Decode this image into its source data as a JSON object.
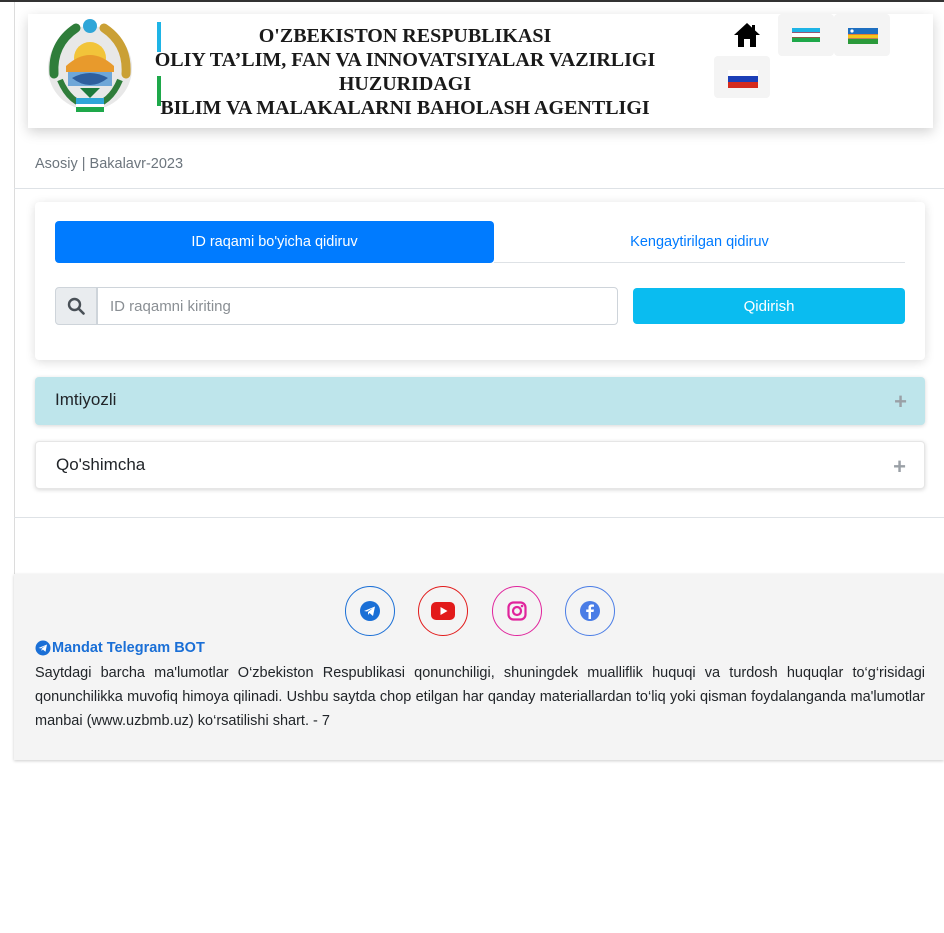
{
  "header": {
    "title_line1": "O'ZBEKISTON RESPUBLIKASI",
    "title_line2": "OLIY TA’LIM, FAN VA INNOVATSIYALAR VAZIRLIGI",
    "title_line3": "HUZURIDAGI",
    "title_line4": "BILIM VA MALAKALARNI BAHOLASH AGENTLIGI",
    "icons": [
      "emblem-icon",
      "home-icon",
      "flag-uz-icon",
      "flag-karakalpak-icon",
      "flag-ru-icon"
    ]
  },
  "breadcrumb": "Asosiy | Bakalavr-2023",
  "search": {
    "tab_active": "ID raqami bo'yicha qidiruv",
    "tab_inactive": "Kengaytirilgan qidiruv",
    "placeholder": "ID raqamni kiriting",
    "value": "",
    "button": "Qidirish"
  },
  "accordion": [
    {
      "label": "Imtiyozli",
      "toggle": "+"
    },
    {
      "label": "Qo'shimcha",
      "toggle": "+"
    }
  ],
  "footer": {
    "social": [
      "telegram-icon",
      "youtube-icon",
      "instagram-icon",
      "facebook-icon"
    ],
    "bot_label": "Mandat Telegram BOT",
    "text": "Saytdagi barcha ma'lumotlar O‘zbekiston Respublikasi qonunchiligi, shuningdek mualliflik huquqi va turdosh huquqlar to‘g‘risidagi qonunchilikka muvofiq himoya qilinadi. Ushbu saytda chop etilgan har qanday materiallardan to‘liq yoki qisman foydalanganda ma'lumotlar manbai (www.uzbmb.uz) ko‘rsatilishi shart. - 7"
  },
  "colors": {
    "primary": "#007bff",
    "search_button": "#0abcf0",
    "accordion_active": "#bee5eb",
    "footer_bg": "#f4f4f4"
  }
}
